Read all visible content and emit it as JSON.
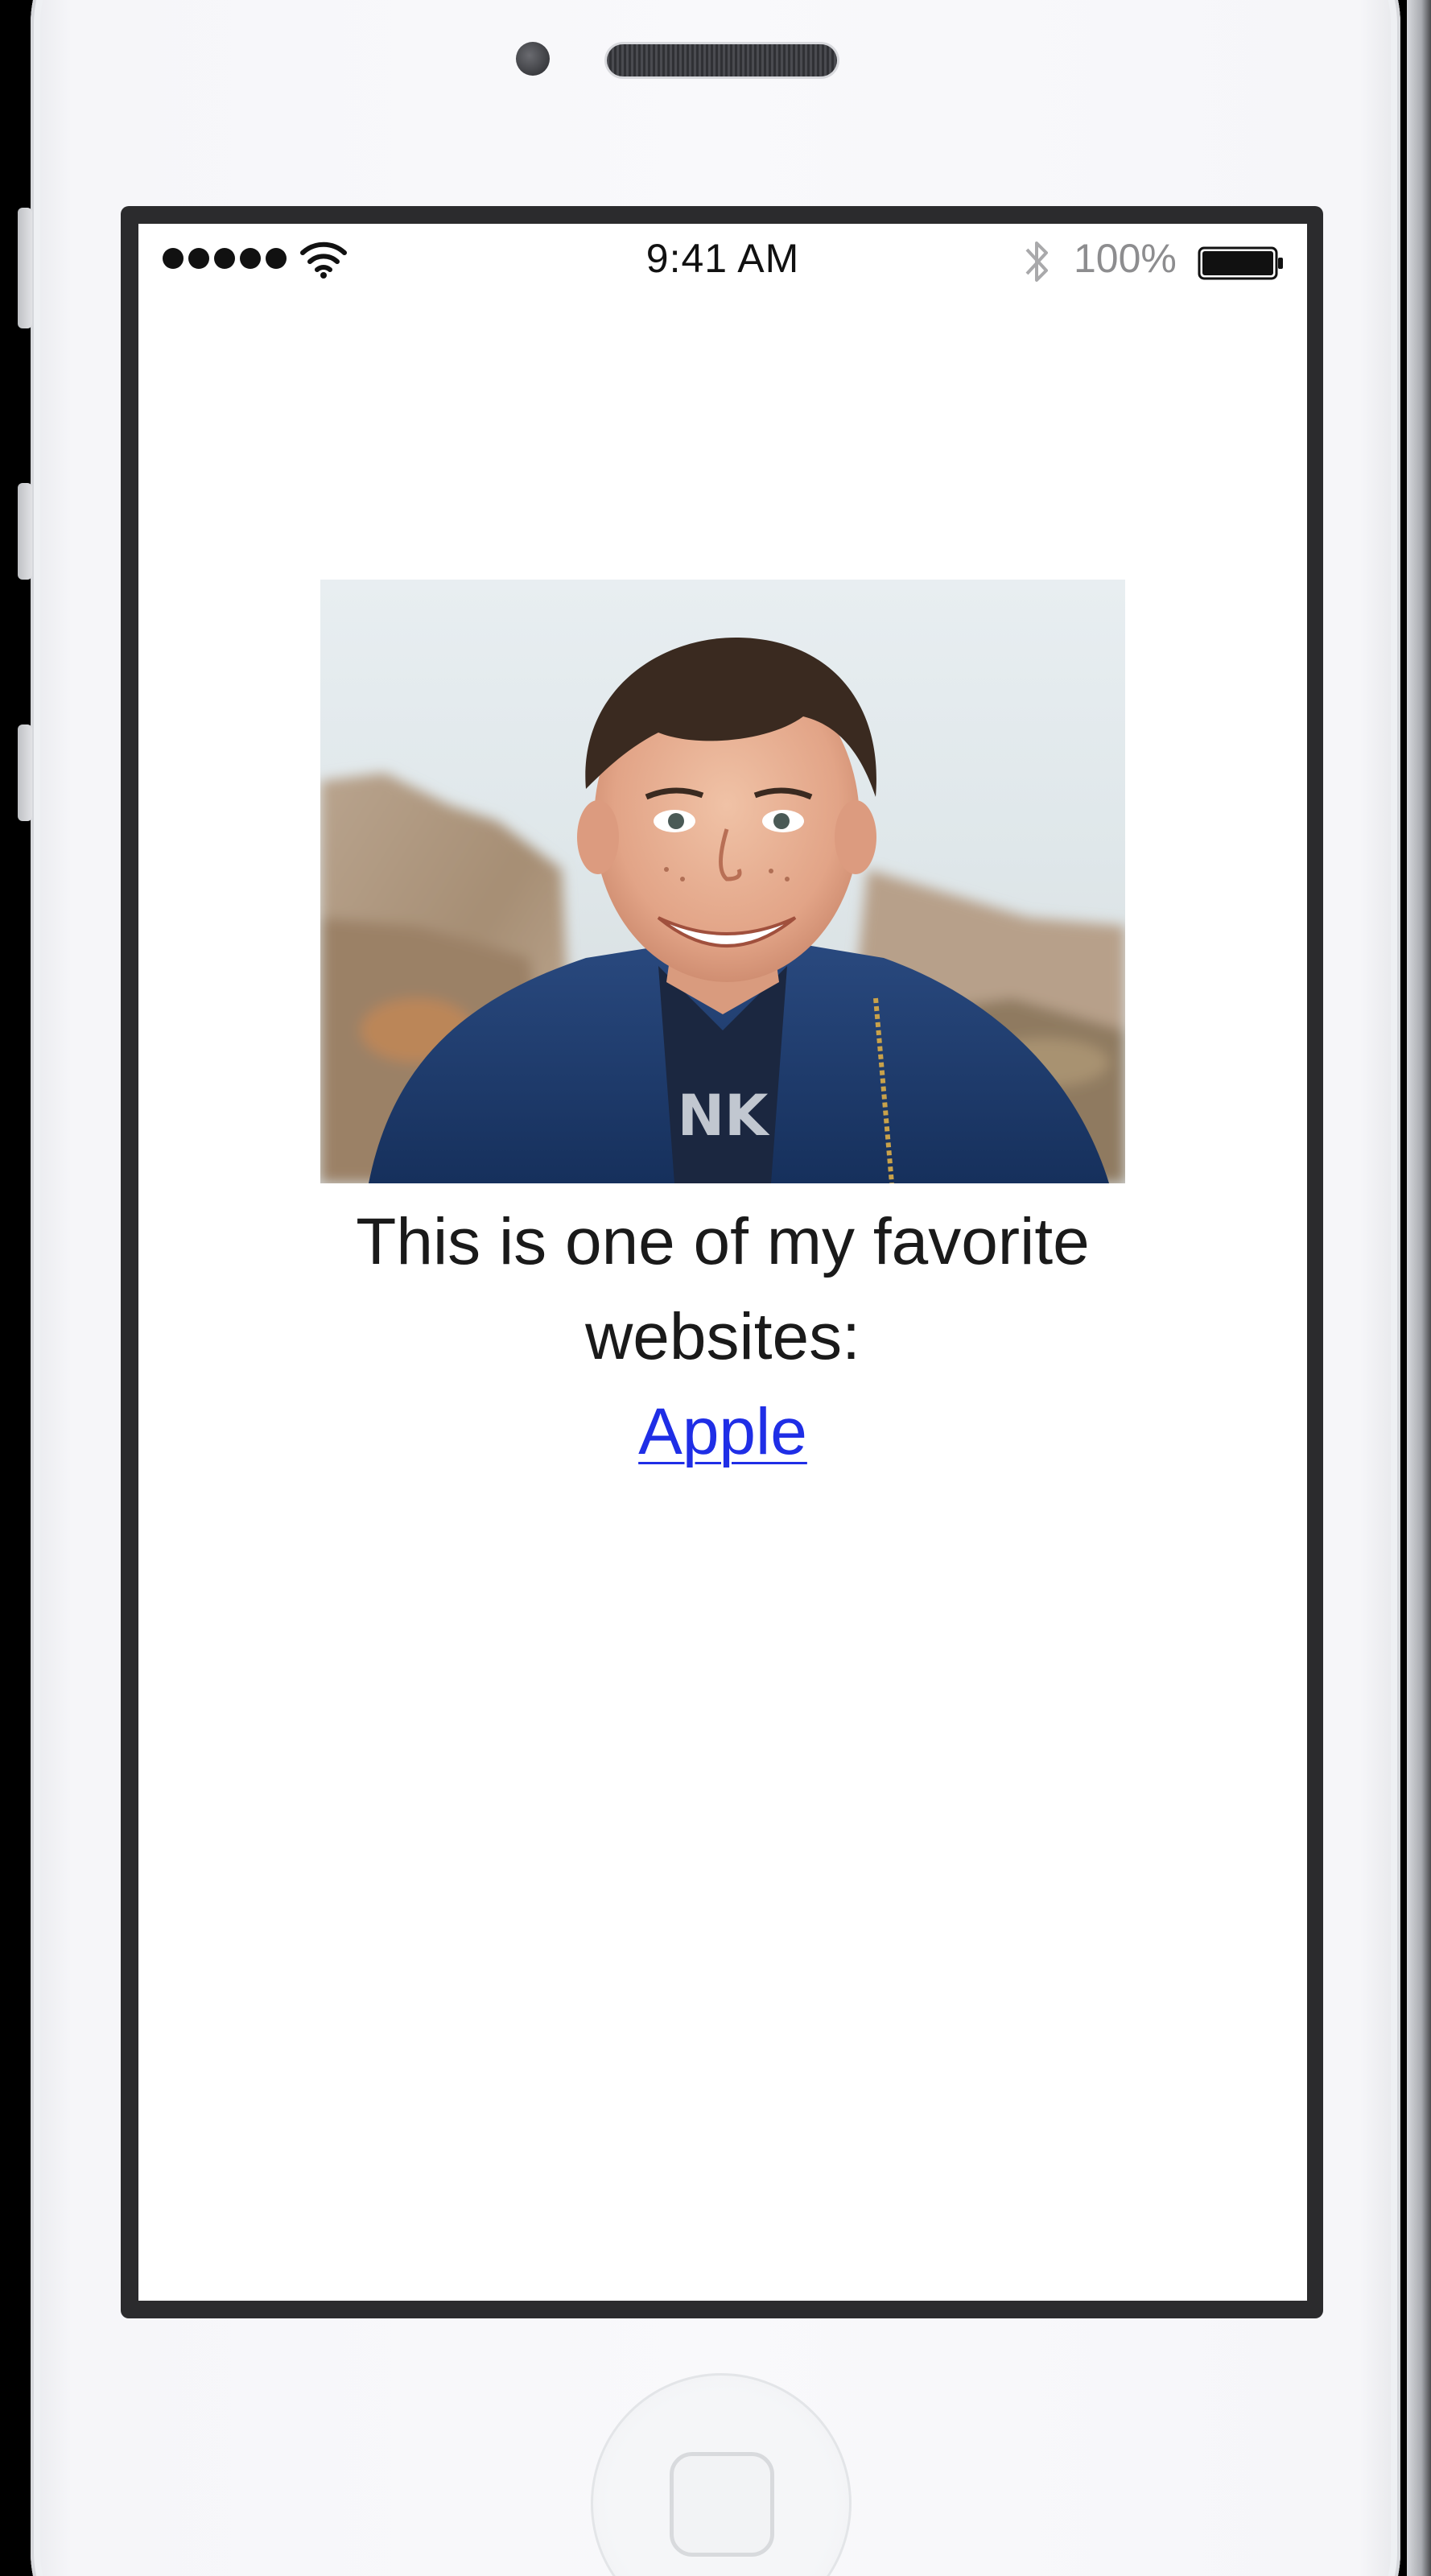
{
  "status_bar": {
    "time": "9:41 AM",
    "battery_percent": "100%",
    "signal_bars": 5,
    "battery_level": 1.0
  },
  "page": {
    "caption": "This is one of my favorite websites:",
    "link_text": "Apple"
  },
  "icons": [
    "signal-dots-icon",
    "wifi-icon",
    "bluetooth-icon",
    "battery-icon",
    "home-button-icon"
  ],
  "colors": {
    "link": "#1f2ee6",
    "text": "#1a1a1a",
    "status_secondary": "#8d8d8f",
    "jacket": "#1f3a68"
  }
}
